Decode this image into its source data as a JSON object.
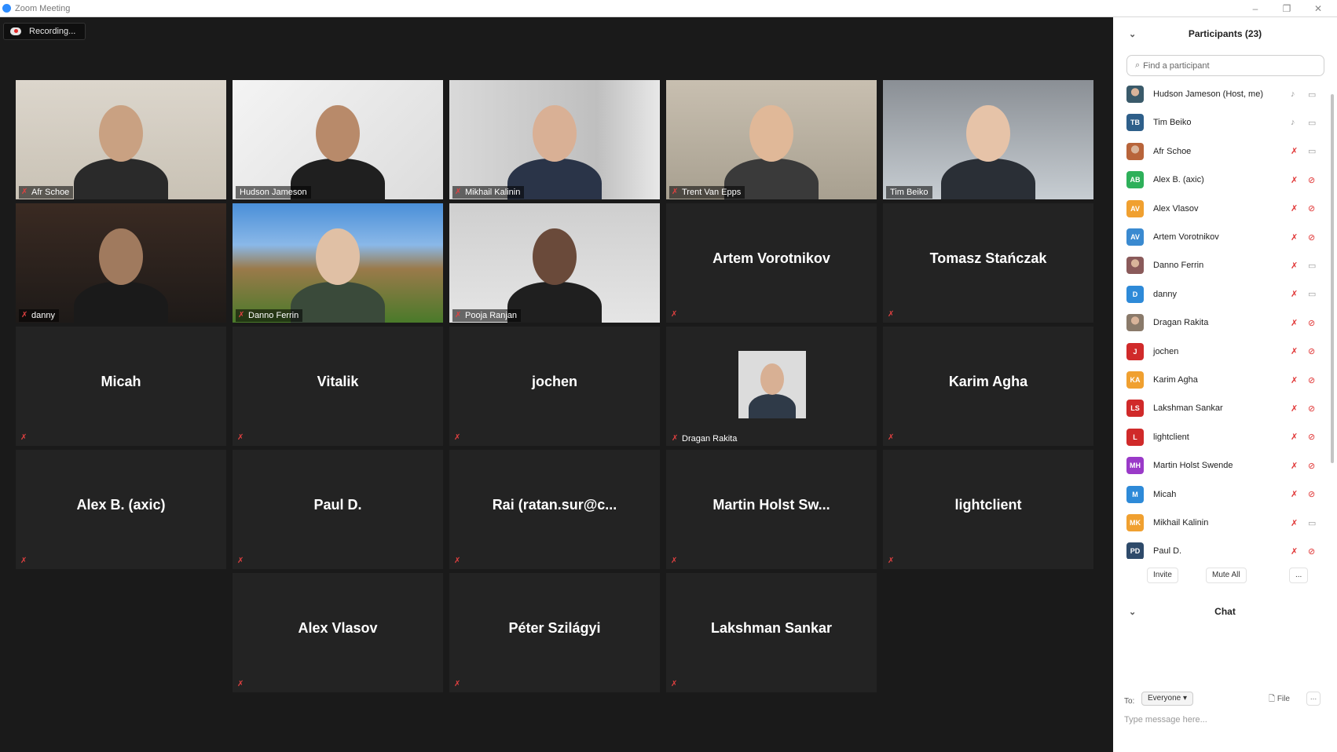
{
  "window": {
    "title": "Zoom Meeting",
    "controls": [
      "–",
      "❐",
      "✕"
    ]
  },
  "recording": {
    "label": "Recording..."
  },
  "gallery": {
    "tiles": [
      {
        "name": "Afr Schoe",
        "video": true,
        "muted": true
      },
      {
        "name": "Hudson Jameson",
        "video": true,
        "muted": false,
        "active": true
      },
      {
        "name": "Mikhail Kalinin",
        "video": true,
        "muted": true
      },
      {
        "name": "Trent Van Epps",
        "video": true,
        "muted": true
      },
      {
        "name": "Tim Beiko",
        "video": true,
        "muted": false
      },
      {
        "name": "danny",
        "video": true,
        "muted": true
      },
      {
        "name": "Danno Ferrin",
        "video": true,
        "muted": true
      },
      {
        "name": "Pooja Ranjan",
        "video": true,
        "muted": true
      },
      {
        "name": "Artem Vorotnikov",
        "video": false,
        "muted": true
      },
      {
        "name": "Tomasz Stańczak",
        "video": false,
        "muted": true
      },
      {
        "name": "Micah",
        "video": false,
        "muted": true
      },
      {
        "name": "Vitalik",
        "video": false,
        "muted": true
      },
      {
        "name": "jochen",
        "video": false,
        "muted": true
      },
      {
        "name": "Dragan Rakita",
        "video": false,
        "avatar": true,
        "muted": true
      },
      {
        "name": "Karim Agha",
        "video": false,
        "muted": true
      },
      {
        "name": "Alex B. (axic)",
        "video": false,
        "muted": true
      },
      {
        "name": "Paul D.",
        "video": false,
        "muted": true
      },
      {
        "name": "Rai  (ratan.sur@c...",
        "video": false,
        "muted": true
      },
      {
        "name": "Martin Holst Sw...",
        "video": false,
        "muted": true
      },
      {
        "name": "lightclient",
        "video": false,
        "muted": true
      },
      {
        "name": "Alex Vlasov",
        "video": false,
        "muted": true
      },
      {
        "name": "Péter Szilágyi",
        "video": false,
        "muted": true
      },
      {
        "name": "Lakshman Sankar",
        "video": false,
        "muted": true
      }
    ]
  },
  "participants": {
    "header": "Participants (23)",
    "search_placeholder": "Find a participant",
    "items": [
      {
        "name": "Hudson Jameson (Host, me)",
        "initials": "",
        "color": "#3a5a6a",
        "mic": "on",
        "cam": "on",
        "photo": true
      },
      {
        "name": "Tim Beiko",
        "initials": "TB",
        "color": "#2e5f8a",
        "mic": "on",
        "cam": "on"
      },
      {
        "name": "Afr Schoe",
        "initials": "",
        "color": "#b8643a",
        "mic": "muted",
        "cam": "on",
        "photo": true
      },
      {
        "name": "Alex B. (axic)",
        "initials": "AB",
        "color": "#2eb05a",
        "mic": "muted",
        "cam": "off"
      },
      {
        "name": "Alex Vlasov",
        "initials": "AV",
        "color": "#f0a030",
        "mic": "muted",
        "cam": "off"
      },
      {
        "name": "Artem Vorotnikov",
        "initials": "AV",
        "color": "#3a8ad0",
        "mic": "muted",
        "cam": "off"
      },
      {
        "name": "Danno Ferrin",
        "initials": "",
        "color": "#8a5a5a",
        "mic": "muted",
        "cam": "on",
        "photo": true
      },
      {
        "name": "danny",
        "initials": "D",
        "color": "#2e8ad8",
        "mic": "muted",
        "cam": "on"
      },
      {
        "name": "Dragan Rakita",
        "initials": "",
        "color": "#8a7a6a",
        "mic": "muted",
        "cam": "off",
        "photo": true
      },
      {
        "name": "jochen",
        "initials": "J",
        "color": "#d02a2a",
        "mic": "muted",
        "cam": "off"
      },
      {
        "name": "Karim Agha",
        "initials": "KA",
        "color": "#f0a030",
        "mic": "muted",
        "cam": "off"
      },
      {
        "name": "Lakshman Sankar",
        "initials": "LS",
        "color": "#d02a2a",
        "mic": "muted",
        "cam": "off"
      },
      {
        "name": "lightclient",
        "initials": "L",
        "color": "#d02a2a",
        "mic": "muted",
        "cam": "off"
      },
      {
        "name": "Martin Holst Swende",
        "initials": "MH",
        "color": "#9a3ac8",
        "mic": "muted",
        "cam": "off"
      },
      {
        "name": "Micah",
        "initials": "M",
        "color": "#2e8ad8",
        "mic": "muted",
        "cam": "off"
      },
      {
        "name": "Mikhail Kalinin",
        "initials": "MK",
        "color": "#f0a030",
        "mic": "muted",
        "cam": "on"
      },
      {
        "name": "Paul D.",
        "initials": "PD",
        "color": "#2e4a6a",
        "mic": "muted",
        "cam": "off"
      }
    ],
    "invite_label": "Invite",
    "mute_all_label": "Mute All",
    "more_label": "..."
  },
  "chat": {
    "header": "Chat",
    "to_label": "To:",
    "recipient": "Everyone",
    "file_label": "File",
    "more_label": "...",
    "placeholder": "Type message here..."
  }
}
